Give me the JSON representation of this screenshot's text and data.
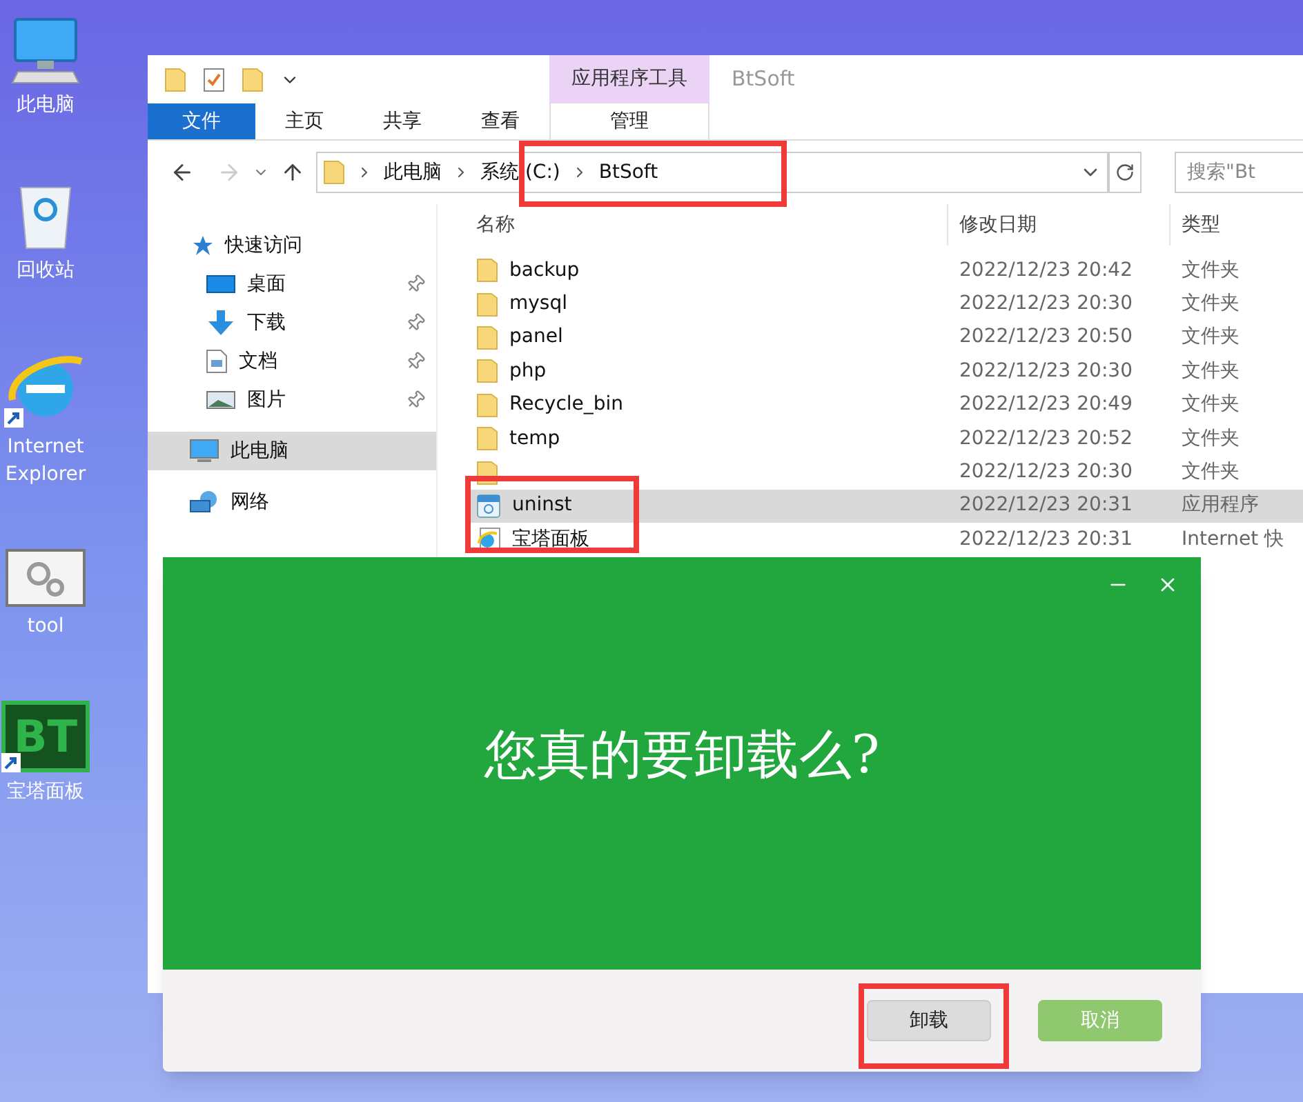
{
  "desktop_icons": [
    {
      "label": "此电脑",
      "kind": "computer",
      "shortcut": false
    },
    {
      "label": "回收站",
      "kind": "recycle",
      "shortcut": false
    },
    {
      "label": "Internet Explorer",
      "kind": "browser",
      "shortcut": true
    },
    {
      "label": "tool",
      "kind": "tool",
      "shortcut": false
    },
    {
      "label": "宝塔面板",
      "kind": "bt",
      "logo_text": "BT",
      "shortcut": true
    }
  ],
  "explorer": {
    "context_tab": "应用程序工具",
    "title": "BtSoft",
    "ribbon_tabs": [
      {
        "label": "文件",
        "kind": "file"
      },
      {
        "label": "主页",
        "kind": "plain"
      },
      {
        "label": "共享",
        "kind": "plain"
      },
      {
        "label": "查看",
        "kind": "plain"
      },
      {
        "label": "管理",
        "kind": "context"
      }
    ],
    "path": [
      "此电脑",
      "系统 (C:)",
      "BtSoft"
    ],
    "search": {
      "placeholder": "搜索\"Bt"
    },
    "nav": [
      {
        "label": "快速访问",
        "kind": "star",
        "selected": false,
        "children": [
          {
            "label": "桌面",
            "kind": "desktop",
            "pinned": true,
            "selected": false
          },
          {
            "label": "下载",
            "kind": "download",
            "pinned": true,
            "selected": false
          },
          {
            "label": "文档",
            "kind": "document",
            "pinned": true,
            "selected": false
          },
          {
            "label": "图片",
            "kind": "pictures",
            "pinned": true,
            "selected": false
          }
        ]
      },
      {
        "label": "此电脑",
        "kind": "computer",
        "selected": true
      },
      {
        "label": "网络",
        "kind": "network",
        "selected": false
      }
    ],
    "columns": [
      "名称",
      "修改日期",
      "类型"
    ],
    "rows": [
      {
        "name": "backup",
        "date": "2022/12/23 20:42",
        "type": "文件夹",
        "kind": "folder",
        "selected": false
      },
      {
        "name": "mysql",
        "date": "2022/12/23 20:30",
        "type": "文件夹",
        "kind": "folder",
        "selected": false
      },
      {
        "name": "panel",
        "date": "2022/12/23 20:50",
        "type": "文件夹",
        "kind": "folder",
        "selected": false
      },
      {
        "name": "php",
        "date": "2022/12/23 20:30",
        "type": "文件夹",
        "kind": "folder",
        "selected": false
      },
      {
        "name": "Recycle_bin",
        "date": "2022/12/23 20:49",
        "type": "文件夹",
        "kind": "folder",
        "selected": false
      },
      {
        "name": "temp",
        "date": "2022/12/23 20:52",
        "type": "文件夹",
        "kind": "folder",
        "selected": false
      },
      {
        "date": "2022/12/23 20:30",
        "type": "文件夹",
        "kind": "folder",
        "selected": false
      },
      {
        "name": "uninst",
        "date": "2022/12/23 20:31",
        "type": "应用程序",
        "kind": "app",
        "selected": true
      },
      {
        "name": "宝塔面板",
        "date": "2022/12/23 20:31",
        "type": "Internet 快",
        "kind": "shortcut",
        "selected": false
      }
    ]
  },
  "dialog": {
    "message": "您真的要卸载么?",
    "buttons": [
      {
        "label": "卸载",
        "kind": "secondary"
      },
      {
        "label": "取消",
        "kind": "primary"
      }
    ]
  }
}
